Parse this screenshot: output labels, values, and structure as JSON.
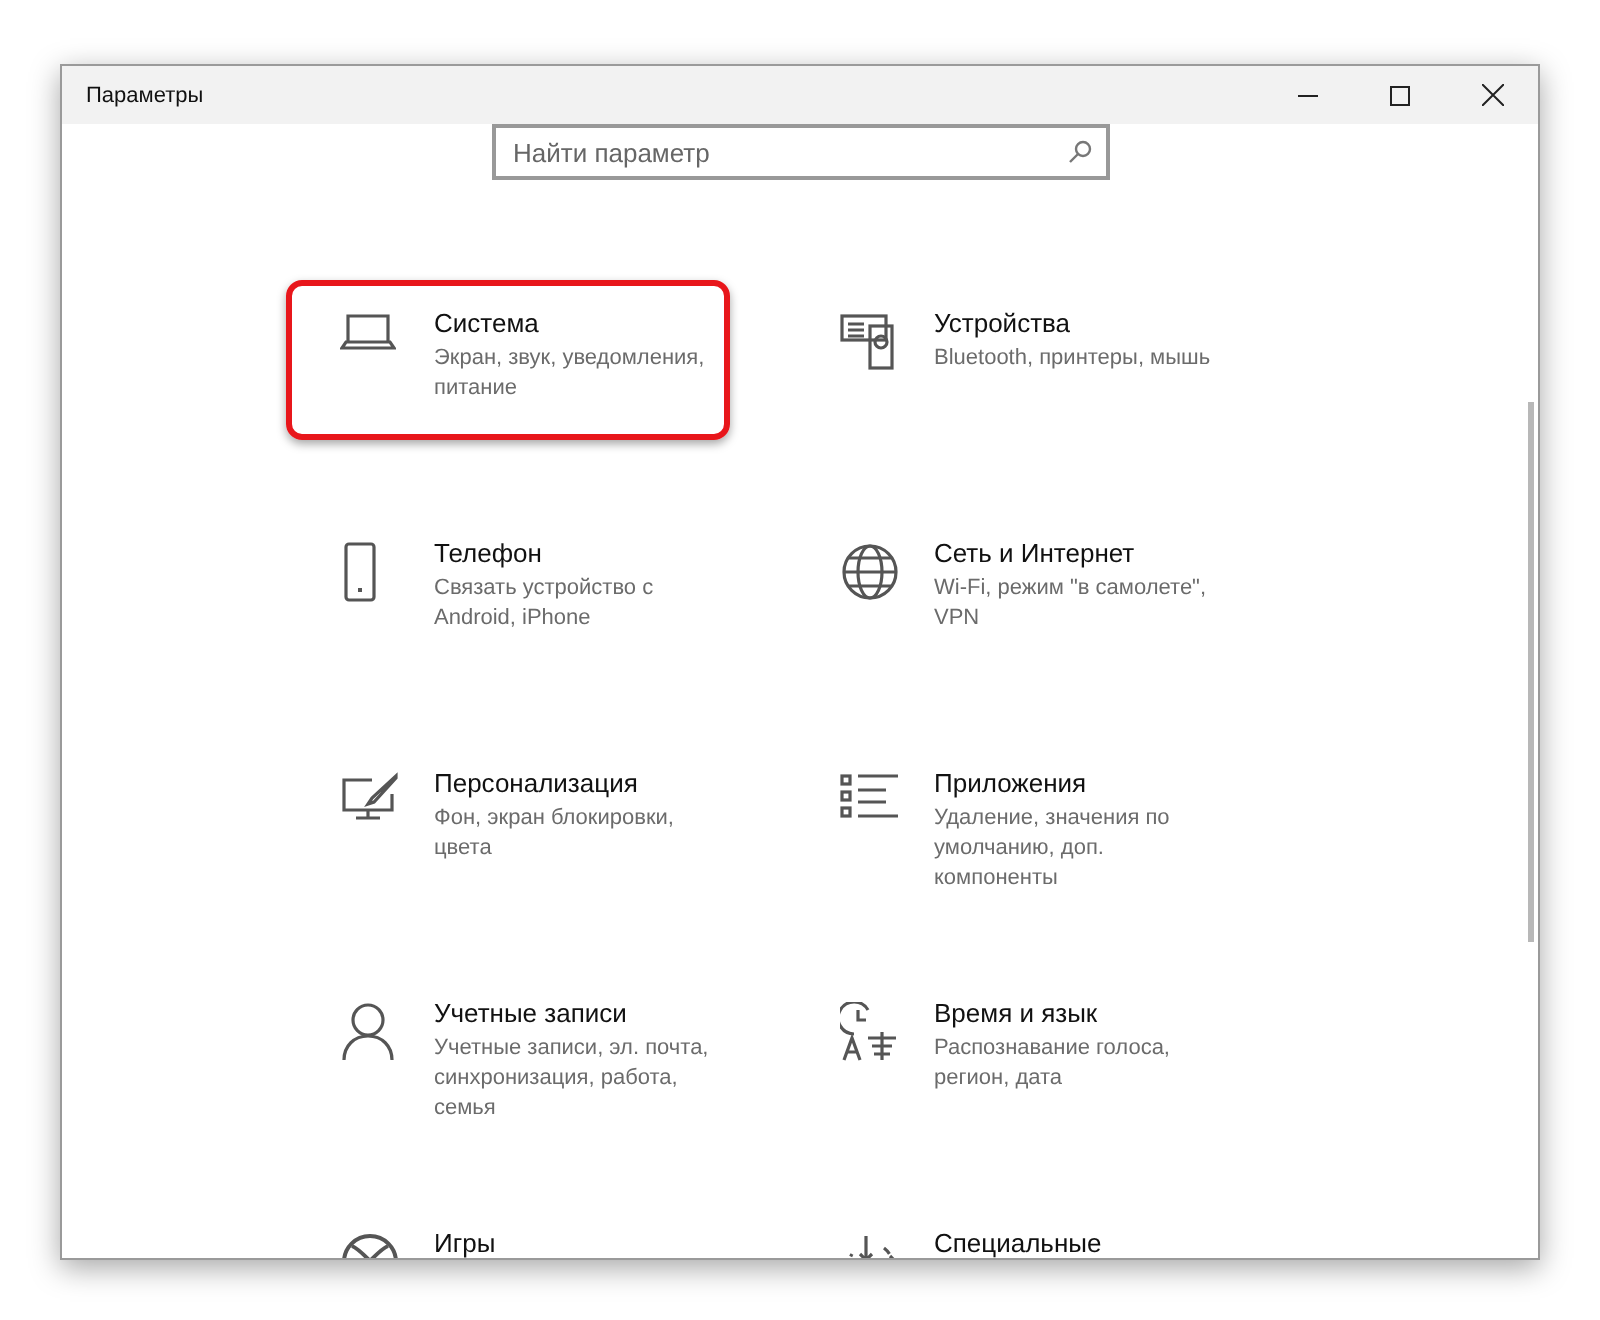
{
  "window": {
    "title": "Параметры"
  },
  "search": {
    "placeholder": "Найти параметр"
  },
  "tiles": [
    {
      "title": "Система",
      "description": "Экран, звук, уведомления, питание",
      "highlighted": true
    },
    {
      "title": "Устройства",
      "description": "Bluetooth, принтеры, мышь",
      "highlighted": false
    },
    {
      "title": "Телефон",
      "description": "Связать устройство с Android, iPhone",
      "highlighted": false
    },
    {
      "title": "Сеть и Интернет",
      "description": "Wi-Fi, режим \"в самолете\", VPN",
      "highlighted": false
    },
    {
      "title": "Персонализация",
      "description": "Фон, экран блокировки, цвета",
      "highlighted": false
    },
    {
      "title": "Приложения",
      "description": "Удаление, значения по умолчанию, доп. компоненты",
      "highlighted": false
    },
    {
      "title": "Учетные записи",
      "description": "Учетные записи, эл. почта, синхронизация, работа, семья",
      "highlighted": false
    },
    {
      "title": "Время и язык",
      "description": "Распознавание голоса, регион, дата",
      "highlighted": false
    },
    {
      "title": "Игры",
      "highlighted": false
    },
    {
      "title": "Специальные",
      "highlighted": false
    }
  ]
}
